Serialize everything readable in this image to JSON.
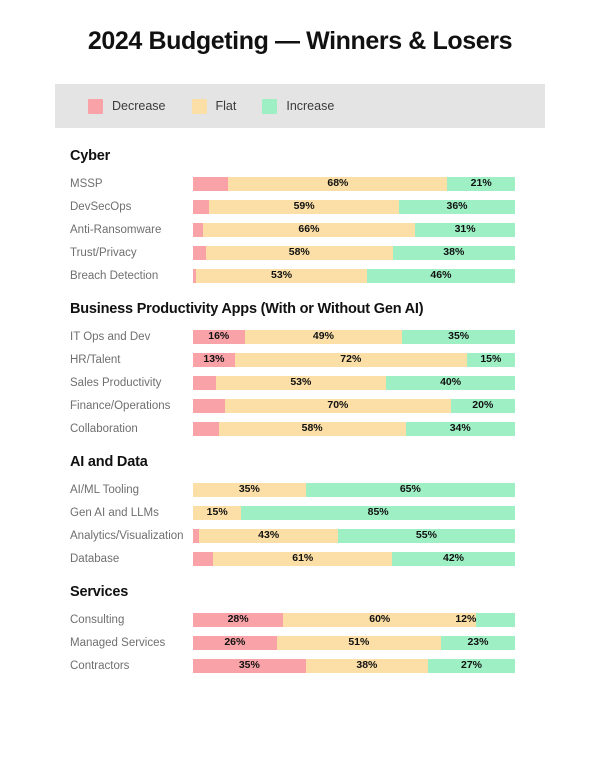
{
  "title": "2024 Budgeting — Winners & Losers",
  "legend": {
    "items": [
      {
        "label": "Decrease",
        "color": "#F9A3A8",
        "key": "decrease"
      },
      {
        "label": "Flat",
        "color": "#FBDFA6",
        "key": "flat"
      },
      {
        "label": "Increase",
        "color": "#9EF0C4",
        "key": "increase"
      }
    ],
    "background": "#E4E4E4"
  },
  "colors": {
    "decrease": "#F9A3A8",
    "flat": "#FBDFA6",
    "increase": "#9EF0C4",
    "title": "#111111",
    "row_label": "#6F6F6F",
    "page_background": "#FFFFFF"
  },
  "chart_data": {
    "type": "bar",
    "subtype": "stacked-horizontal-100",
    "title": "2024 Budgeting — Winners & Losers",
    "xlabel": "",
    "ylabel": "",
    "xlim": [
      0,
      100
    ],
    "grid": false,
    "legend_position": "top",
    "series": [
      {
        "name": "Decrease",
        "color": "#F9A3A8"
      },
      {
        "name": "Flat",
        "color": "#FBDFA6"
      },
      {
        "name": "Increase",
        "color": "#9EF0C4"
      }
    ],
    "groups": [
      {
        "name": "Cyber",
        "rows": [
          {
            "category": "MSSP",
            "decrease": 11,
            "flat": 68,
            "increase": 21
          },
          {
            "category": "DevSecOps",
            "decrease": 5,
            "flat": 59,
            "increase": 36
          },
          {
            "category": "Anti-Ransomware",
            "decrease": 3,
            "flat": 66,
            "increase": 31
          },
          {
            "category": "Trust/Privacy",
            "decrease": 4,
            "flat": 58,
            "increase": 38
          },
          {
            "category": "Breach Detection",
            "decrease": 1,
            "flat": 53,
            "increase": 46
          }
        ]
      },
      {
        "name": "Business Productivity Apps (With or Without Gen AI)",
        "rows": [
          {
            "category": "IT Ops and Dev",
            "decrease": 16,
            "flat": 49,
            "increase": 35
          },
          {
            "category": "HR/Talent",
            "decrease": 13,
            "flat": 72,
            "increase": 15
          },
          {
            "category": "Sales Productivity",
            "decrease": 7,
            "flat": 53,
            "increase": 40
          },
          {
            "category": "Finance/Operations",
            "decrease": 10,
            "flat": 70,
            "increase": 20
          },
          {
            "category": "Collaboration",
            "decrease": 8,
            "flat": 58,
            "increase": 34
          }
        ]
      },
      {
        "name": "AI and Data",
        "rows": [
          {
            "category": "AI/ML Tooling",
            "decrease": 0,
            "flat": 35,
            "increase": 65
          },
          {
            "category": "Gen AI and LLMs",
            "decrease": 0,
            "flat": 15,
            "increase": 85
          },
          {
            "category": "Analytics/Visualization",
            "decrease": 2,
            "flat": 43,
            "increase": 55
          },
          {
            "category": "Database",
            "decrease": 7,
            "flat": 61,
            "increase": 42
          }
        ]
      },
      {
        "name": "Services",
        "rows": [
          {
            "category": "Consulting",
            "decrease": 28,
            "flat": 60,
            "increase": 12
          },
          {
            "category": "Managed Services",
            "decrease": 26,
            "flat": 51,
            "increase": 23
          },
          {
            "category": "Contractors",
            "decrease": 35,
            "flat": 38,
            "increase": 27
          }
        ]
      }
    ]
  }
}
